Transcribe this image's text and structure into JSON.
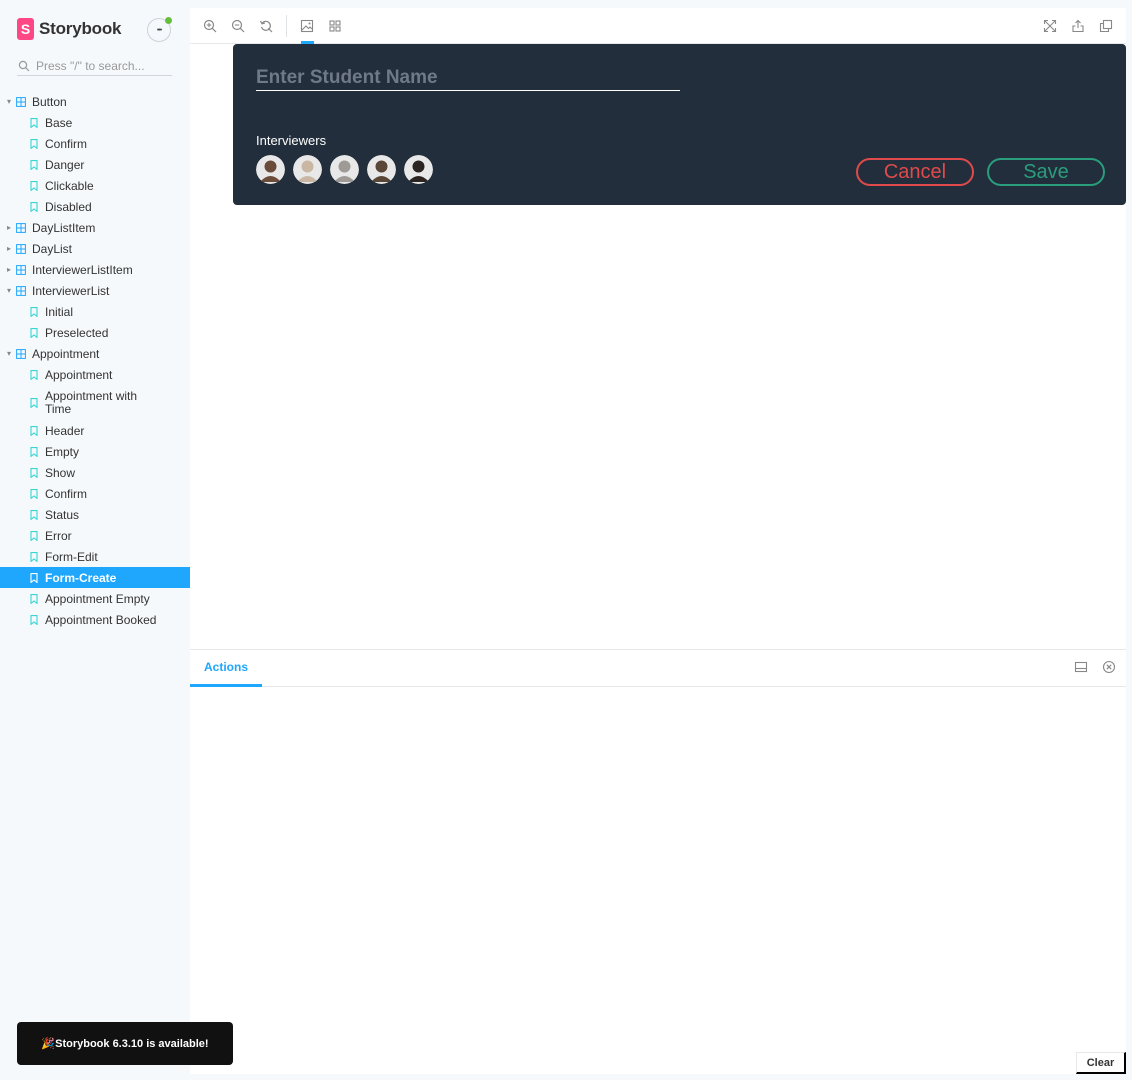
{
  "brand": {
    "name": "Storybook",
    "logo_letter": "S"
  },
  "menu": {
    "label": "•••"
  },
  "search": {
    "placeholder": "Press \"/\" to search..."
  },
  "tree": [
    {
      "label": "Button",
      "kind": "group",
      "expanded": true
    },
    {
      "label": "Base",
      "kind": "story"
    },
    {
      "label": "Confirm",
      "kind": "story"
    },
    {
      "label": "Danger",
      "kind": "story"
    },
    {
      "label": "Clickable",
      "kind": "story"
    },
    {
      "label": "Disabled",
      "kind": "story"
    },
    {
      "label": "DayListItem",
      "kind": "group",
      "expanded": false
    },
    {
      "label": "DayList",
      "kind": "group",
      "expanded": false
    },
    {
      "label": "InterviewerListItem",
      "kind": "group",
      "expanded": false
    },
    {
      "label": "InterviewerList",
      "kind": "group",
      "expanded": true
    },
    {
      "label": "Initial",
      "kind": "story"
    },
    {
      "label": "Preselected",
      "kind": "story"
    },
    {
      "label": "Appointment",
      "kind": "group",
      "expanded": true
    },
    {
      "label": "Appointment",
      "kind": "story"
    },
    {
      "label": "Appointment with Time",
      "kind": "story",
      "tall": true
    },
    {
      "label": "Header",
      "kind": "story"
    },
    {
      "label": "Empty",
      "kind": "story"
    },
    {
      "label": "Show",
      "kind": "story"
    },
    {
      "label": "Confirm",
      "kind": "story"
    },
    {
      "label": "Status",
      "kind": "story"
    },
    {
      "label": "Error",
      "kind": "story"
    },
    {
      "label": "Form-Edit",
      "kind": "story"
    },
    {
      "label": "Form-Create",
      "kind": "story",
      "selected": true
    },
    {
      "label": "Appointment Empty",
      "kind": "story"
    },
    {
      "label": "Appointment Booked",
      "kind": "story"
    }
  ],
  "form": {
    "student_placeholder": "Enter Student Name",
    "student_value": "",
    "interviewers_label": "Interviewers",
    "cancel_label": "Cancel",
    "save_label": "Save",
    "avatar_tones": [
      "#6b4b3a",
      "#c9b7a4",
      "#9e9a96",
      "#5a4636",
      "#2c2420"
    ]
  },
  "addons": {
    "tab_label": "Actions",
    "clear_label": "Clear"
  },
  "toast": {
    "text": "🎉Storybook 6.3.10 is available!"
  },
  "colors": {
    "accent": "#1ea7fd",
    "brand": "#ff4785",
    "card_bg": "#222e3c",
    "cancel": "#e04a4a",
    "save": "#2a9d7c"
  }
}
